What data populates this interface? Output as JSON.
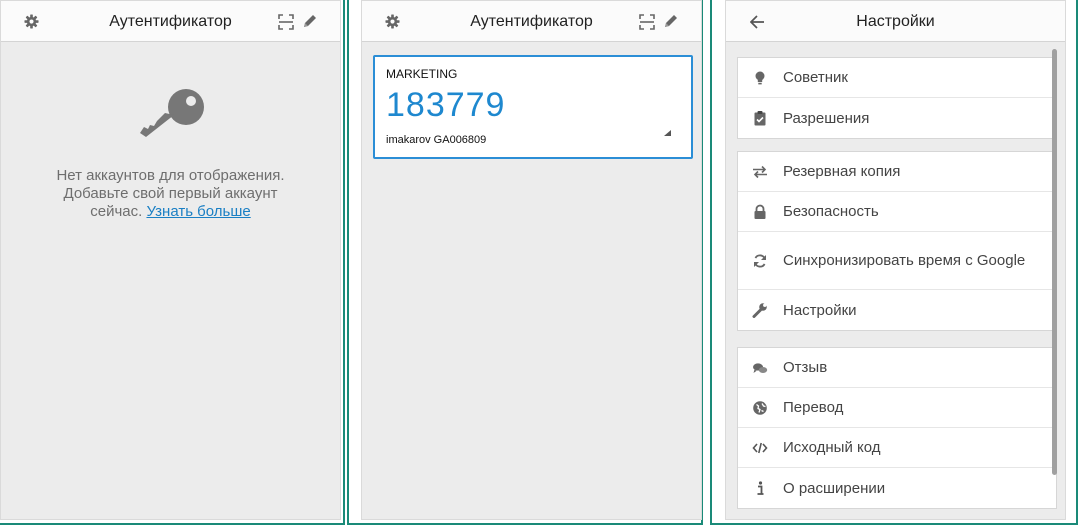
{
  "panel1": {
    "title": "Аутентификатор",
    "empty_line1": "Нет аккаунтов для отображения.",
    "empty_line2": "Добавьте свой первый аккаунт",
    "empty_line3": "сейчас.",
    "learn_more": "Узнать больше"
  },
  "panel2": {
    "title": "Аутентификатор",
    "entry": {
      "issuer": "MARKETING",
      "code": "183779",
      "account": "imakarov GA006809"
    }
  },
  "panel3": {
    "title": "Настройки",
    "groups": [
      [
        {
          "label": "Советник",
          "icon": "lightbulb-icon"
        },
        {
          "label": "Разрешения",
          "icon": "clipboard-check-icon"
        }
      ],
      [
        {
          "label": "Резервная копия",
          "icon": "exchange-icon"
        },
        {
          "label": "Безопасность",
          "icon": "lock-icon"
        },
        {
          "label": "Синхронизировать время с Google",
          "icon": "sync-icon"
        },
        {
          "label": "Настройки",
          "icon": "wrench-icon"
        }
      ],
      [
        {
          "label": "Отзыв",
          "icon": "comments-icon"
        },
        {
          "label": "Перевод",
          "icon": "globe-icon"
        },
        {
          "label": "Исходный код",
          "icon": "code-icon"
        },
        {
          "label": "О расширении",
          "icon": "info-icon"
        }
      ]
    ]
  },
  "colors": {
    "accent": "#1e88cf",
    "frame": "#1a8a78",
    "icon": "#6b6b6b"
  }
}
